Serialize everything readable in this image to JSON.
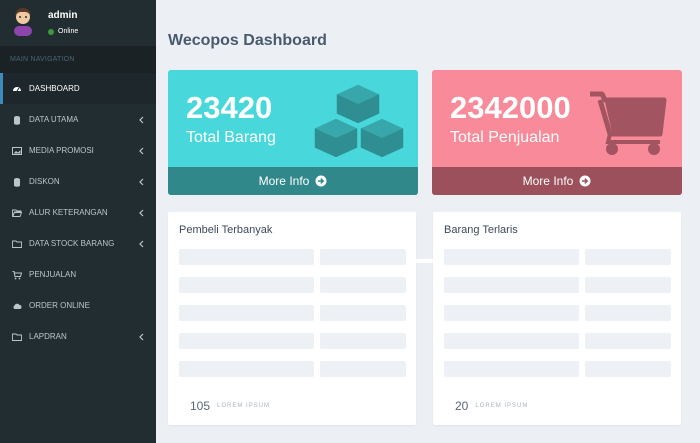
{
  "user": {
    "name": "admin",
    "status": "Online"
  },
  "nav": {
    "header": "MAIN NAVIGATION",
    "items": [
      {
        "label": "DASHBOARD",
        "icon": "dashboard-icon",
        "active": true,
        "chevron": false
      },
      {
        "label": "DATA UTAMA",
        "icon": "database-icon",
        "chevron": true
      },
      {
        "label": "MEDIA PROMOSI",
        "icon": "image-icon",
        "chevron": true
      },
      {
        "label": "DISKON",
        "icon": "database-icon",
        "chevron": true
      },
      {
        "label": "ALUR KETERANGAN",
        "icon": "folder-open-icon",
        "chevron": true
      },
      {
        "label": "DATA STOCK BARANG",
        "icon": "folder-icon",
        "chevron": true
      },
      {
        "label": "PENJUALAN",
        "icon": "cart-icon",
        "chevron": false
      },
      {
        "label": "ORDER ONLINE",
        "icon": "cloud-icon",
        "chevron": false
      },
      {
        "label": "LAPDRAN",
        "icon": "folder-icon",
        "chevron": true
      }
    ]
  },
  "page": {
    "title": "Wecopos Dashboard"
  },
  "stats": [
    {
      "value": "23420",
      "label": "Total Barang",
      "footer": "More Info",
      "icon": "cubes-icon",
      "color": "#48d8dc"
    },
    {
      "value": "2342000",
      "label": "Total Penjualan",
      "footer": "More Info",
      "icon": "shopping-cart-icon",
      "color": "#f88a99"
    }
  ],
  "panels": [
    {
      "title": "Pembeli Terbanyak",
      "footer_number": "105",
      "footer_label": "LOREM IPSUM"
    },
    {
      "title": "Barang Terlaris",
      "footer_number": "20",
      "footer_label": "LOREM IPSUM"
    }
  ]
}
